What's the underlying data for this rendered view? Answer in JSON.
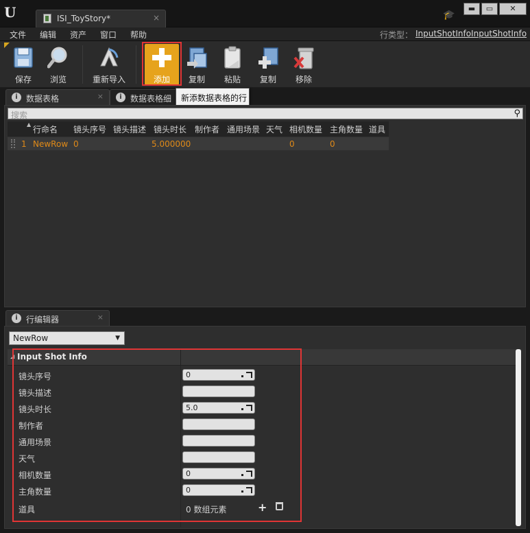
{
  "window": {
    "tab_label": "ISI_ToyStory*",
    "tab_close": "×",
    "minimize": "▬",
    "maximize": "▭",
    "close": "✕"
  },
  "menu": {
    "items": [
      "文件",
      "编辑",
      "资产",
      "窗口",
      "帮助"
    ],
    "row_type_label": "行类型：",
    "row_type_value": "InputShotInfoInputShotInfo"
  },
  "toolbar": {
    "save": "保存",
    "browse": "浏览",
    "reimport": "重新导入",
    "add": "添加",
    "copy": "复制",
    "paste": "粘贴",
    "duplicate": "复制",
    "remove": "移除",
    "add_tooltip": "新添数据表格的行"
  },
  "panel_tabs": {
    "data_table": "数据表格",
    "data_table_details": "数据表格细节",
    "row_editor": "行编辑器",
    "close": "×"
  },
  "table": {
    "search_placeholder": "搜索",
    "columns": [
      "行命名",
      "镜头序号",
      "镜头描述",
      "镜头时长",
      "制作者",
      "通用场景",
      "天气",
      "相机数量",
      "主角数量",
      "道具"
    ],
    "rows": [
      {
        "index": "1",
        "name": "NewRow",
        "shot_no": "0",
        "shot_desc": "",
        "duration": "5.000000",
        "author": "",
        "scene": "",
        "weather": "",
        "camera_count": "0",
        "lead_count": "0",
        "props": ""
      }
    ]
  },
  "row_editor": {
    "selected_row": "NewRow",
    "category": "Input Shot Info",
    "properties": [
      {
        "label": "镜头序号",
        "value": "0",
        "numeric": true
      },
      {
        "label": "镜头描述",
        "value": "",
        "numeric": false
      },
      {
        "label": "镜头时长",
        "value": "5.0",
        "numeric": true
      },
      {
        "label": "制作者",
        "value": "",
        "numeric": false
      },
      {
        "label": "通用场景",
        "value": "",
        "numeric": false
      },
      {
        "label": "天气",
        "value": "",
        "numeric": false
      },
      {
        "label": "相机数量",
        "value": "0",
        "numeric": true
      },
      {
        "label": "主角数量",
        "value": "0",
        "numeric": true
      }
    ],
    "array_label": "道具",
    "array_value": "0 数组元素"
  },
  "colors": {
    "accent_add": "#e6a31c",
    "highlight": "#e23535",
    "row_value": "#e08a18"
  }
}
